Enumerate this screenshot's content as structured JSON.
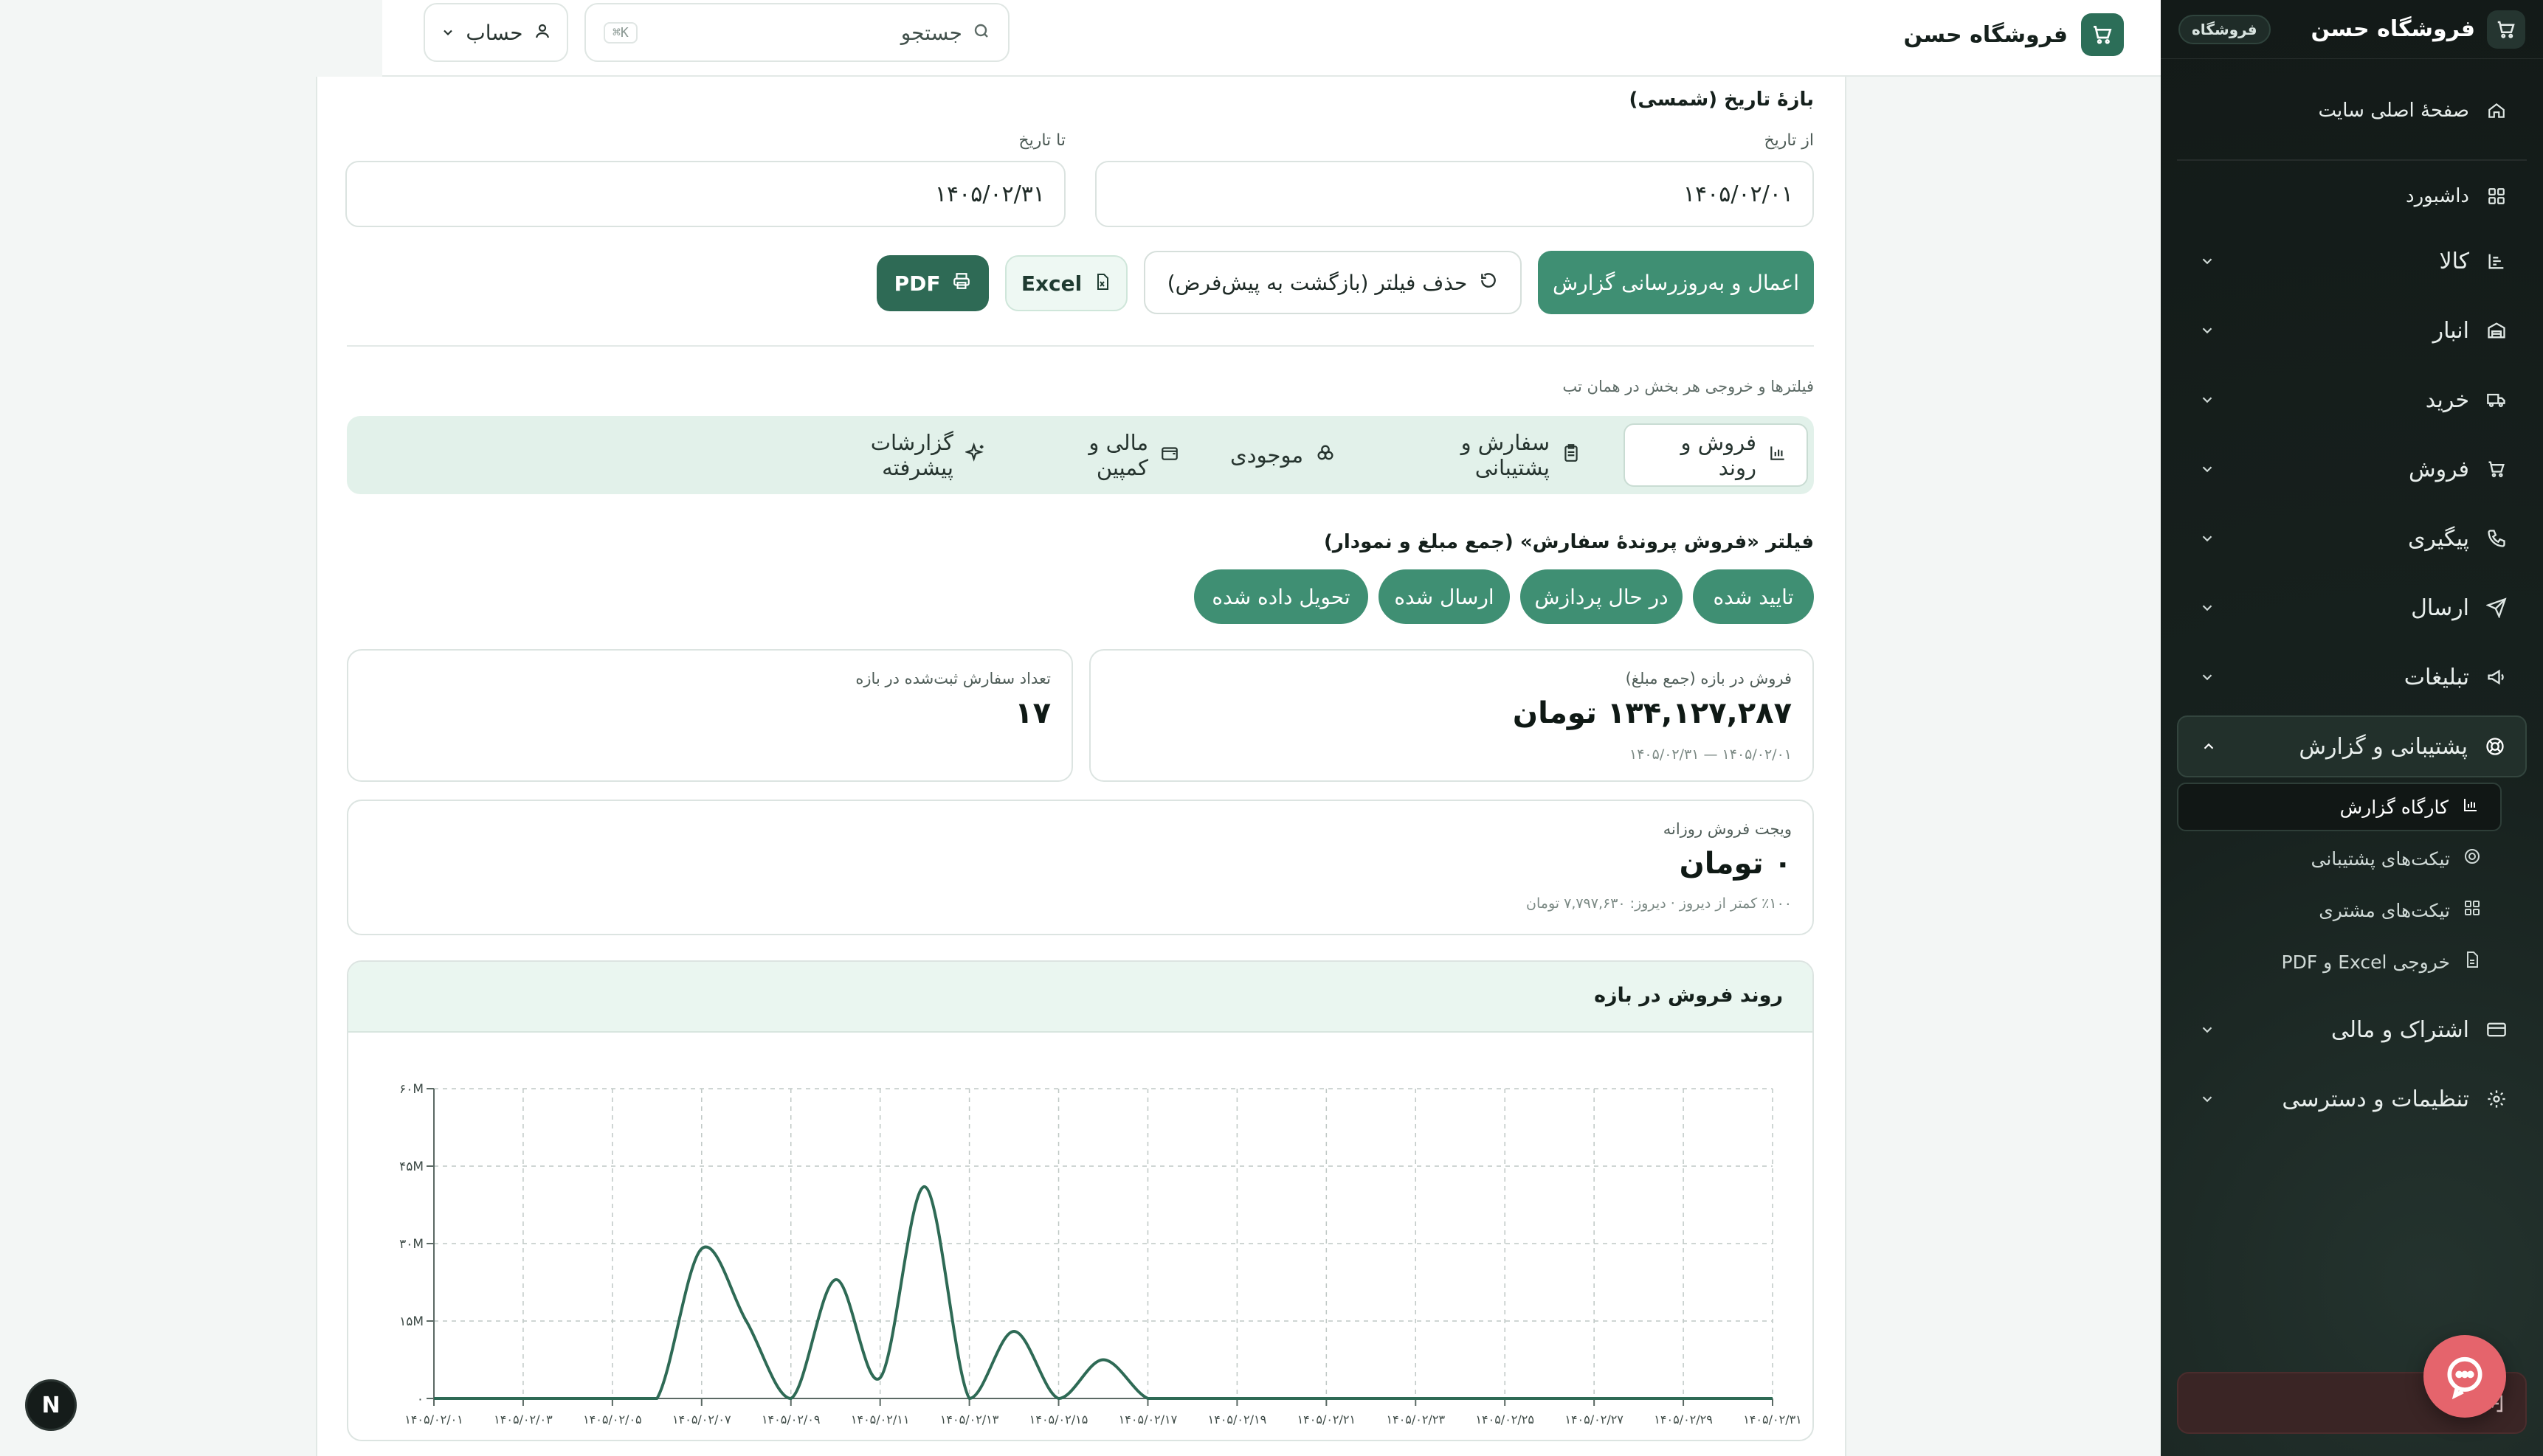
{
  "topbar": {
    "store_name": "فروشگاه حسن",
    "search_placeholder": "جستجو",
    "search_shortcut": "⌘K",
    "account_label": "حساب"
  },
  "sidebar": {
    "title": "فروشگاه حسن",
    "badge": "فروشگاه",
    "home_label": "صفحهٔ اصلی سایت",
    "items": [
      {
        "label": "داشبورد",
        "icon": "dashboard-icon"
      },
      {
        "label": "کالا",
        "icon": "products-icon"
      },
      {
        "label": "انبار",
        "icon": "warehouse-icon"
      },
      {
        "label": "خرید",
        "icon": "truck-icon"
      },
      {
        "label": "فروش",
        "icon": "cart-icon"
      },
      {
        "label": "پیگیری",
        "icon": "phone-icon"
      },
      {
        "label": "ارسال",
        "icon": "send-icon"
      },
      {
        "label": "تبلیغات",
        "icon": "megaphone-icon"
      },
      {
        "label": "پشتیبانی و گزارش",
        "icon": "lifebuoy-icon"
      },
      {
        "label": "اشتراک و مالی",
        "icon": "card-icon"
      },
      {
        "label": "تنظیمات و دسترسی",
        "icon": "gear-icon"
      }
    ],
    "subitems": [
      {
        "label": "کارگاه گزارش",
        "icon": "chart-icon"
      },
      {
        "label": "تیکت‌های پشتیبانی",
        "icon": "lifebuoy-icon"
      },
      {
        "label": "تیکت‌های مشتری",
        "icon": "grid-icon"
      },
      {
        "label": "خروجی Excel و PDF",
        "icon": "file-icon"
      }
    ]
  },
  "filters": {
    "range_title": "بازهٔ تاریخ (شمسی)",
    "from_label": "از تاریخ",
    "from_value": "۱۴۰۵/۰۲/۰۱",
    "to_label": "تا تاریخ",
    "to_value": "۱۴۰۵/۰۲/۳۱",
    "apply_button": "اعمال و به‌روزرسانی گزارش",
    "reset_button": "حذف فیلتر (بازگشت به پیش‌فرض)",
    "excel_button": "Excel",
    "pdf_button": "PDF",
    "tabs_hint": "فیلترها و خروجی هر بخش در همان تب"
  },
  "tabs": [
    {
      "label": "فروش و روند",
      "icon": "bar-chart-icon",
      "active": true
    },
    {
      "label": "سفارش و پشتیبانی",
      "icon": "clipboard-icon",
      "active": false
    },
    {
      "label": "موجودی",
      "icon": "boxes-icon",
      "active": false
    },
    {
      "label": "مالی و کمپین",
      "icon": "wallet-icon",
      "active": false
    },
    {
      "label": "گزارشات پیشرفته",
      "icon": "sparkles-icon",
      "active": false
    }
  ],
  "status_filter": {
    "title": "فیلتر «فروش پروندهٔ سفارش» (جمع مبلغ و نمودار)",
    "chips": [
      "تایید شده",
      "در حال پردازش",
      "ارسال شده",
      "تحویل داده شده"
    ]
  },
  "kpis": {
    "sales": {
      "caption": "فروش در بازه (جمع مبلغ)",
      "value": "۱۳۴,۱۲۷,۲۸۷ تومان",
      "range": "۱۴۰۵/۰۲/۰۱ — ۱۴۰۵/۰۲/۳۱"
    },
    "orders": {
      "caption": "تعداد سفارش ثبت‌شده در بازه",
      "value": "۱۷"
    },
    "daily_widget": {
      "caption": "ویجت فروش روزانه",
      "value": "۰ تومان",
      "note": "٪۱۰۰ کمتر از دیروز · دیروز: ۷,۷۹۷,۶۳۰ تومان"
    }
  },
  "chart_data": {
    "type": "line",
    "title": "روند فروش در بازه",
    "x_ticks": [
      "۱۴۰۵/۰۲/۰۱",
      "۱۴۰۵/۰۲/۰۳",
      "۱۴۰۵/۰۲/۰۵",
      "۱۴۰۵/۰۲/۰۷",
      "۱۴۰۵/۰۲/۰۹",
      "۱۴۰۵/۰۲/۱۱",
      "۱۴۰۵/۰۲/۱۳",
      "۱۴۰۵/۰۲/۱۵",
      "۱۴۰۵/۰۲/۱۷",
      "۱۴۰۵/۰۲/۱۹",
      "۱۴۰۵/۰۲/۲۱",
      "۱۴۰۵/۰۲/۲۳",
      "۱۴۰۵/۰۲/۲۵",
      "۱۴۰۵/۰۲/۲۷",
      "۱۴۰۵/۰۲/۲۹",
      "۱۴۰۵/۰۲/۳۱"
    ],
    "y_ticks": [
      "۰",
      "۱۵M",
      "۳۰M",
      "۴۵M",
      "۶۰M"
    ],
    "ylim": [
      0,
      60000000
    ],
    "day_values": [
      0,
      0,
      0,
      0,
      0,
      0,
      29000000,
      15000000,
      0,
      23000000,
      4000000,
      41000000,
      0,
      13000000,
      0,
      7500000,
      0,
      0,
      0,
      0,
      0,
      0,
      0,
      0,
      0,
      0,
      0,
      0,
      0,
      0,
      0
    ],
    "line_color": "#2e6a55",
    "grid": true
  },
  "misc": {
    "next_badge": "N"
  }
}
